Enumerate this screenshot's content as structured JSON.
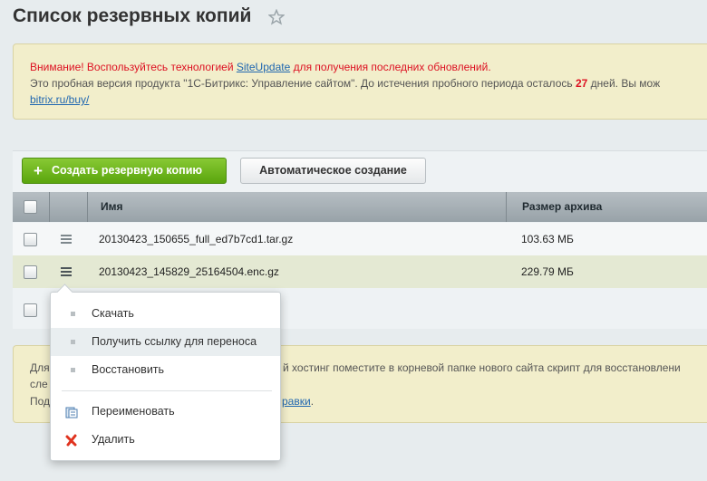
{
  "page": {
    "title": "Список резервных копий"
  },
  "notice": {
    "line1_prefix": "Внимание! Воспользуйтесь технологией ",
    "line1_link": "SiteUpdate",
    "line1_suffix": " для получения последних обновлений.",
    "line2_prefix": "Это пробная версия продукта \"1С-Битрикс: Управление сайтом\". До истечения пробного периода осталось ",
    "line2_days": "27",
    "line2_suffix": " дней. Вы мож",
    "line3_link": "bitrix.ru/buy/"
  },
  "toolbar": {
    "create_label": "Создать резервную копию",
    "auto_label": "Автоматическое создание"
  },
  "table": {
    "columns": [
      "Имя",
      "Размер архива"
    ],
    "rows": [
      {
        "name": "20130423_150655_full_ed7b7cd1.tar.gz",
        "size": "103.63 МБ"
      },
      {
        "name": "20130423_145829_25164504.enc.gz",
        "size": "229.79 МБ"
      }
    ]
  },
  "footer_note": {
    "line1_left": "Для",
    "line1_right": "й хостинг поместите в корневой папке нового сайта скрипт для восстановлени",
    "line2_left": "сле",
    "line3_left": "Под",
    "line3_link": "равки",
    "line3_tail": "."
  },
  "context_menu": {
    "items": [
      "Скачать",
      "Получить ссылку для переноса",
      "Восстановить",
      "Переименовать",
      "Удалить"
    ]
  },
  "colors": {
    "accent_green": "#6ab517",
    "link_blue": "#2067b0",
    "warning_red": "#dd1122"
  }
}
